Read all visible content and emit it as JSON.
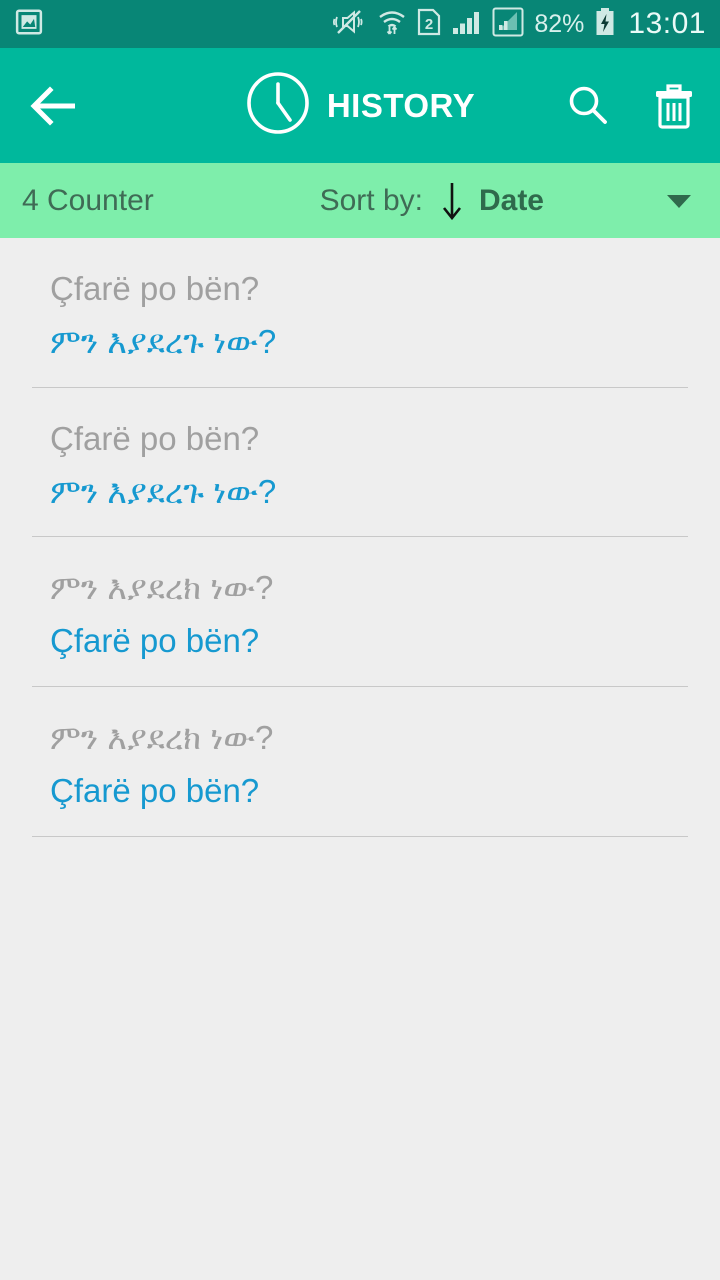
{
  "status_bar": {
    "background_color": "#088676",
    "notification_icon": "image-notification-icon",
    "icons": [
      "vibrate-mute-icon",
      "wifi-data-icon",
      "sim2-icon",
      "signal-bars-icon",
      "signal-bars-secondary-icon"
    ],
    "battery_percent": "82%",
    "battery_state": "charging",
    "time": "13:01"
  },
  "app_bar": {
    "background_color": "#00b89c",
    "back_label": "Back",
    "title": "HISTORY",
    "clock_icon": "clock-icon",
    "search_label": "Search",
    "delete_label": "Delete all"
  },
  "sort_bar": {
    "background_color": "#7eeeab",
    "counter": "4 Counter",
    "sort_by_label": "Sort by:",
    "sort_direction": "descending",
    "sort_value": "Date",
    "dropdown_icon": "chevron-down-icon"
  },
  "history": {
    "items": [
      {
        "source": "Çfarë po bën?",
        "target": "ምን እያደረጉ ነው?"
      },
      {
        "source": "Çfarë po bën?",
        "target": "ምን እያደረጉ ነው?"
      },
      {
        "source": "ምን እያደረክ ነው?",
        "target": "Çfarë po bën?"
      },
      {
        "source": "ምን እያደረክ ነው?",
        "target": "Çfarë po bën?"
      }
    ]
  },
  "colors": {
    "source_text": "#a0a0a0",
    "target_text": "#1699d0",
    "page_background": "#eeeeee"
  }
}
